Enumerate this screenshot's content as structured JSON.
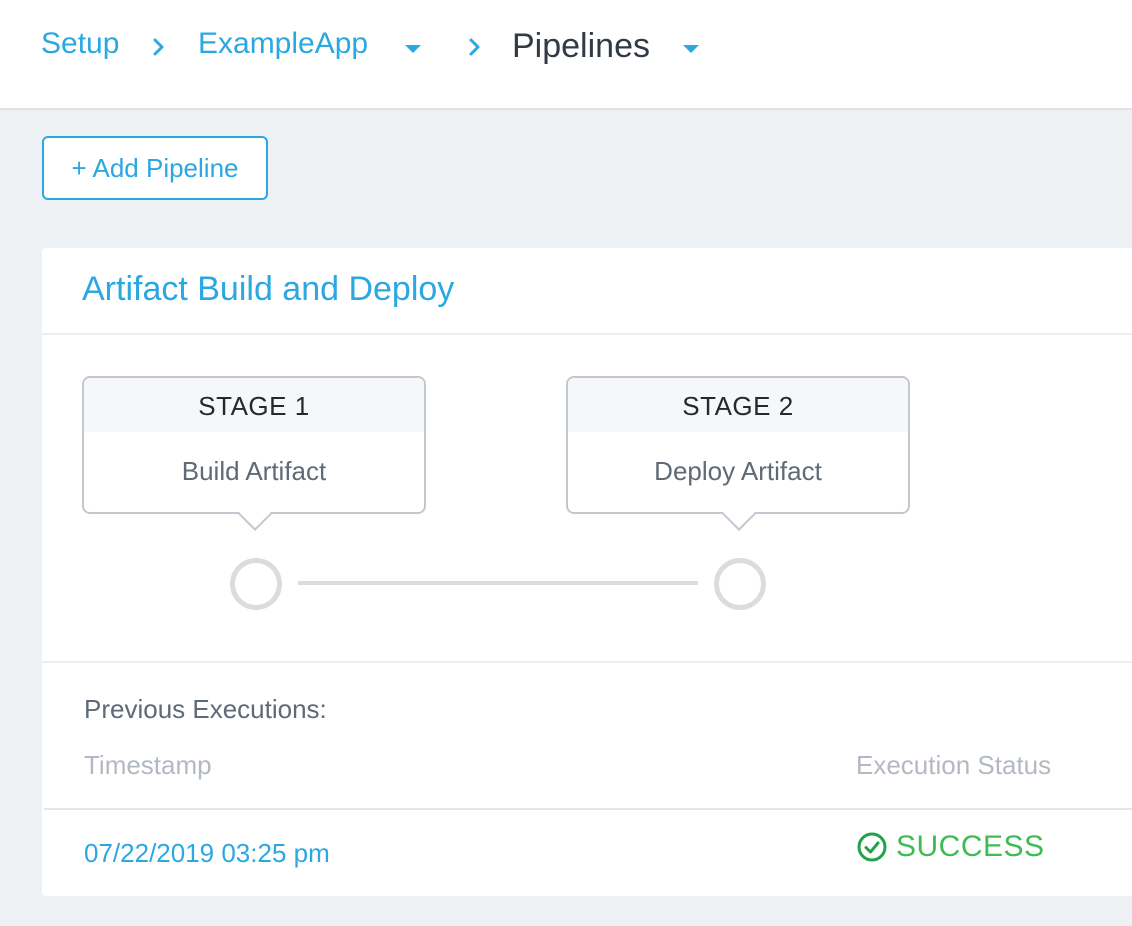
{
  "breadcrumb": {
    "items": [
      {
        "label": "Setup"
      },
      {
        "label": "ExampleApp"
      },
      {
        "label": "Pipelines"
      }
    ]
  },
  "toolbar": {
    "add_pipeline_label": "+ Add Pipeline"
  },
  "pipeline": {
    "title": "Artifact Build and Deploy",
    "stages": [
      {
        "label": "STAGE 1",
        "name": "Build Artifact"
      },
      {
        "label": "STAGE 2",
        "name": "Deploy Artifact"
      }
    ]
  },
  "executions": {
    "heading": "Previous Executions:",
    "columns": [
      "Timestamp",
      "Execution Status"
    ],
    "rows": [
      {
        "timestamp": "07/22/2019 03:25 pm",
        "status": "SUCCESS"
      }
    ]
  },
  "icons": {
    "breadcrumb_separator": "chevron-right-icon",
    "dropdown": "caret-down-icon",
    "status": "check-circle-icon"
  },
  "colors": {
    "accent": "#2ba7e1",
    "success": "#3dbc54",
    "background": "#eef1f4",
    "node_ring": "#dcdcdc"
  }
}
